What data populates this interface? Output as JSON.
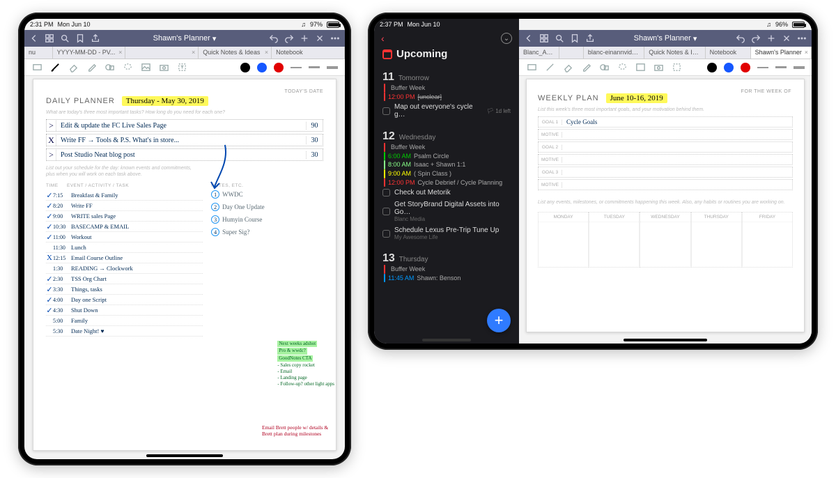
{
  "left_ipad": {
    "status": {
      "time": "2:31 PM",
      "date": "Mon Jun 10",
      "battery": "97%"
    },
    "app_title": "Shawn's Planner",
    "tabs": [
      "nu",
      "YYYY-MM-DD - PV...",
      "",
      "Quick Notes & Ideas",
      "Notebook"
    ],
    "page": {
      "corner": "TODAY'S DATE",
      "title": "DAILY PLANNER",
      "date_hand": "Thursday - May 30, 2019",
      "hint1": "What are today's three most important tasks? How long do you need for each one?",
      "tasks": [
        {
          "tick": ">",
          "text": "Edit & update the FC Live Sales Page",
          "mins": "90"
        },
        {
          "tick": "X",
          "text": "Write FF → Tools & P.S. What's in store...",
          "mins": "30"
        },
        {
          "tick": ">",
          "text": "Post Studio Neat blog post",
          "mins": "30"
        }
      ],
      "hint2a": "List out your schedule for the day: known events and commitments,",
      "hint2b": "plus when you will work on each task above.",
      "sched_hdr": {
        "c1": "TIME",
        "c2": "EVENT / ACTIVITY / TASK"
      },
      "schedule": [
        {
          "ck": "✓",
          "t": "7:15",
          "a": "Breakfast & Family"
        },
        {
          "ck": "✓",
          "t": "8:20",
          "a": "Write FF"
        },
        {
          "ck": "✓",
          "t": "9:00",
          "a": "WRITE sales Page"
        },
        {
          "ck": "✓",
          "t": "10:30",
          "a": "BASECAMP & EMAIL"
        },
        {
          "ck": "✓",
          "t": "11:00",
          "a": "Workout"
        },
        {
          "ck": "",
          "t": "11:30",
          "a": "Lunch"
        },
        {
          "ck": "X",
          "t": "12:15",
          "a": "Email Course Outline"
        },
        {
          "ck": "",
          "t": "1:30",
          "a": "READING → Clockwork"
        },
        {
          "ck": "✓",
          "t": "2:30",
          "a": "TSS Org Chart"
        },
        {
          "ck": "✓",
          "t": "3:30",
          "a": "Things, tasks"
        },
        {
          "ck": "✓",
          "t": "4:00",
          "a": "Day one Script"
        },
        {
          "ck": "✓",
          "t": "4:30",
          "a": "Shut Down"
        },
        {
          "ck": "",
          "t": "5:00",
          "a": "Family"
        },
        {
          "ck": "",
          "t": "5:30",
          "a": "Date Night! ♥"
        }
      ],
      "notes_hdr": "NOTES, ETC.",
      "notes": [
        {
          "n": "1",
          "label": "WWDC"
        },
        {
          "n": "2",
          "label": "Day One Update"
        },
        {
          "n": "3",
          "label": "Humyin Course"
        },
        {
          "n": "4",
          "label": "Super Sig?"
        }
      ],
      "green": {
        "l1": "Next weeks adshot",
        "l2": "Pro & wwdc?",
        "l3": "GoodNotes CTA",
        "bul": [
          "- Sales copy rocket",
          "- Email",
          "- Landing page",
          "- Follow-up? other light apps"
        ]
      },
      "red": "Email Brett people w/ details & Brett plan during milestones"
    }
  },
  "right_ipad": {
    "status": {
      "time": "2:37 PM",
      "date": "Mon Jun 10",
      "battery": "96%"
    },
    "things": {
      "title": "Upcoming",
      "days": [
        {
          "num": "11",
          "dow": "Tomorrow",
          "events": [
            {
              "color": "#f33",
              "time": "",
              "text": "Buffer Week"
            },
            {
              "color": "#f33",
              "time": "12:00 PM",
              "text": "[unclear]",
              "strike": true
            }
          ],
          "todos": [
            {
              "text": "Map out everyone's cycle g…",
              "tag": "1d left",
              "flag": true
            }
          ]
        },
        {
          "num": "12",
          "dow": "Wednesday",
          "events": [
            {
              "color": "#f33",
              "time": "",
              "text": "Buffer Week"
            },
            {
              "color": "#0c0",
              "time": "6:00 AM",
              "text": "Psalm Circle"
            },
            {
              "color": "#8f8",
              "time": "8:00 AM",
              "text": "Isaac + Shawn 1:1"
            },
            {
              "color": "#ff0",
              "time": "9:00 AM",
              "text": "( Spin Class )"
            },
            {
              "color": "#f33",
              "time": "12:00 PM",
              "text": "Cycle Debrief / Cycle Planning"
            }
          ],
          "todos": [
            {
              "text": "Check out Metorik"
            },
            {
              "text": "Get StoryBrand Digital Assets into Go…",
              "sub": "Blanc Media"
            },
            {
              "text": "Schedule Lexus Pre-Trip Tune Up",
              "sub": "My Awesome Life"
            }
          ]
        },
        {
          "num": "13",
          "dow": "Thursday",
          "events": [
            {
              "color": "#f33",
              "time": "",
              "text": "Buffer Week"
            },
            {
              "color": "#09f",
              "time": "11:45 AM",
              "text": "Shawn: Benson"
            }
          ],
          "todos": []
        }
      ]
    },
    "gn": {
      "app_title": "Shawn's Planner",
      "tabs": [
        "Blanc_An...",
        "",
        "blanc-einannvidden...",
        "Quick Notes & Ideas",
        "Notebook",
        "Shawn's Planner"
      ],
      "page": {
        "corner": "FOR THE WEEK OF",
        "title": "WEEKLY PLAN",
        "date_hand": "June 10-16, 2019",
        "hint1": "List this week's three most important goals, and your motivation behind them.",
        "goals": [
          {
            "label": "GOAL 1",
            "text": "Cycle Goals"
          },
          {
            "label": "MOTIVE",
            "text": ""
          },
          {
            "label": "GOAL 2",
            "text": ""
          },
          {
            "label": "MOTIVE",
            "text": ""
          },
          {
            "label": "GOAL 3",
            "text": ""
          },
          {
            "label": "MOTIVE",
            "text": ""
          }
        ],
        "hint2": "List any events, milestones, or commitments happening this week. Also, any habits or routines you are working on.",
        "week": [
          "MONDAY",
          "TUESDAY",
          "WEDNESDAY",
          "THURSDAY",
          "FRIDAY"
        ]
      }
    }
  }
}
